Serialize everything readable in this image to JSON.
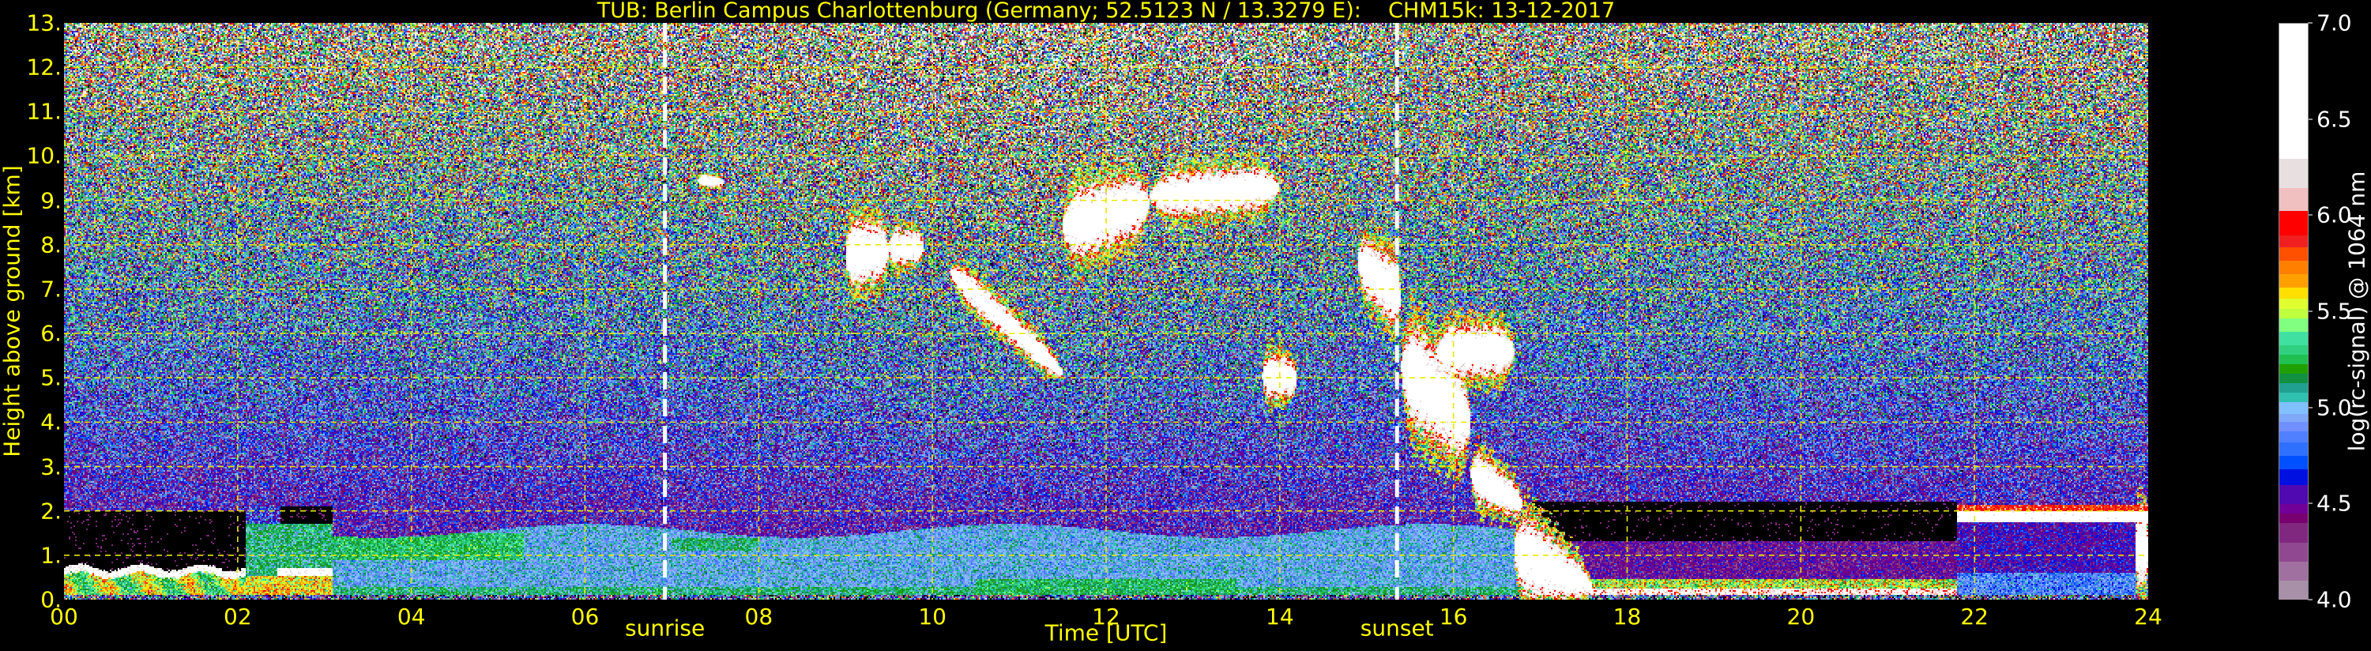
{
  "chart_data": {
    "type": "heatmap",
    "title": "TUB: Berlin Campus Charlottenburg (Germany; 52.5123 N / 13.3279 E):    CHM15k: 13-12-2017",
    "xlabel": "Time [UTC]",
    "ylabel": "Height above ground [km]",
    "xlim": [
      0,
      24
    ],
    "ylim": [
      0,
      13
    ],
    "x_ticks": [
      0,
      2,
      4,
      6,
      8,
      10,
      12,
      14,
      16,
      18,
      20,
      22,
      24
    ],
    "x_tick_labels": [
      "00",
      "02",
      "04",
      "06",
      "08",
      "10",
      "12",
      "14",
      "16",
      "18",
      "20",
      "22",
      "24"
    ],
    "y_ticks": [
      0,
      1,
      2,
      3,
      4,
      5,
      6,
      7,
      8,
      9,
      10,
      11,
      12,
      13
    ],
    "y_tick_labels": [
      "0.",
      "1.",
      "2.",
      "3.",
      "4.",
      "5.",
      "6.",
      "7.",
      "8.",
      "9.",
      "10.",
      "11.",
      "12.",
      "13."
    ],
    "grid": true,
    "annotations": [
      {
        "label": "sunrise",
        "x": 6.92
      },
      {
        "label": "sunset",
        "x": 15.35
      }
    ],
    "colorbar": {
      "label": "log(rc-signal) @ 1064 nm",
      "range": [
        4.0,
        7.0
      ],
      "ticks": [
        4.0,
        4.5,
        5.0,
        5.5,
        6.0,
        6.5,
        7.0
      ],
      "tick_labels": [
        "4.0",
        "4.5",
        "5.0",
        "5.5",
        "6.0",
        "6.5",
        "7.0"
      ],
      "levels": [
        [
          4.0,
          "#a890a8"
        ],
        [
          4.1,
          "#a070a0"
        ],
        [
          4.2,
          "#904890"
        ],
        [
          4.3,
          "#802880"
        ],
        [
          4.4,
          "#780070"
        ],
        [
          4.45,
          "#700098"
        ],
        [
          4.5,
          "#5008b0"
        ],
        [
          4.6,
          "#0010e0"
        ],
        [
          4.68,
          "#0050ff"
        ],
        [
          4.75,
          "#3070ff"
        ],
        [
          4.82,
          "#5080ff"
        ],
        [
          4.88,
          "#7090ff"
        ],
        [
          4.93,
          "#80a8f8"
        ],
        [
          4.97,
          "#80c0ff"
        ],
        [
          5.03,
          "#30c0b0"
        ],
        [
          5.08,
          "#20a090"
        ],
        [
          5.13,
          "#109040"
        ],
        [
          5.18,
          "#20a000"
        ],
        [
          5.23,
          "#20c050"
        ],
        [
          5.28,
          "#30d080"
        ],
        [
          5.33,
          "#40e0a0"
        ],
        [
          5.4,
          "#80ff80"
        ],
        [
          5.47,
          "#c0ff40"
        ],
        [
          5.52,
          "#e0ff30"
        ],
        [
          5.57,
          "#ffe000"
        ],
        [
          5.63,
          "#ffa000"
        ],
        [
          5.7,
          "#ff8000"
        ],
        [
          5.77,
          "#ff5000"
        ],
        [
          5.84,
          "#f02020"
        ],
        [
          5.9,
          "#ff0000"
        ],
        [
          6.03,
          "#f0c0c0"
        ],
        [
          6.15,
          "#e8e0e0"
        ],
        [
          6.3,
          "#ffffff"
        ]
      ]
    },
    "cloud_features": [
      {
        "t": [
          7.3,
          7.6
        ],
        "bottom": [
          9.3,
          9.3
        ],
        "top": [
          9.6,
          9.5
        ]
      },
      {
        "t": [
          9.0,
          9.5
        ],
        "bottom": [
          7.0,
          7.2
        ],
        "top": [
          8.6,
          8.5
        ]
      },
      {
        "t": [
          9.5,
          9.9
        ],
        "bottom": [
          7.5,
          7.6
        ],
        "top": [
          8.4,
          8.3
        ]
      },
      {
        "t": [
          10.2,
          11.5
        ],
        "bottom": [
          7.0,
          4.8
        ],
        "top": [
          7.8,
          5.4
        ]
      },
      {
        "t": [
          11.5,
          12.5
        ],
        "bottom": [
          7.5,
          8.3
        ],
        "top": [
          9.3,
          9.6
        ]
      },
      {
        "t": [
          12.5,
          14.0
        ],
        "bottom": [
          8.6,
          8.8
        ],
        "top": [
          9.6,
          9.8
        ]
      },
      {
        "t": [
          13.8,
          14.2
        ],
        "bottom": [
          4.5,
          4.6
        ],
        "top": [
          5.6,
          5.4
        ]
      },
      {
        "t": [
          14.9,
          15.4
        ],
        "bottom": [
          7.0,
          6.0
        ],
        "top": [
          8.3,
          7.6
        ]
      },
      {
        "t": [
          15.4,
          16.2
        ],
        "bottom": [
          4.0,
          3.0
        ],
        "top": [
          6.5,
          5.0
        ]
      },
      {
        "t": [
          15.8,
          16.7
        ],
        "bottom": [
          5.0,
          5.0
        ],
        "top": [
          6.2,
          6.2
        ]
      },
      {
        "t": [
          16.2,
          16.8
        ],
        "bottom": [
          2.2,
          1.8
        ],
        "top": [
          3.5,
          2.5
        ]
      },
      {
        "t": [
          16.7,
          17.6
        ],
        "bottom": [
          0.0,
          0.0
        ],
        "top": [
          2.2,
          0.6
        ]
      },
      {
        "t": [
          23.85,
          24.0
        ],
        "bottom": [
          0.3,
          0.3
        ],
        "top": [
          2.0,
          2.0
        ]
      }
    ]
  }
}
